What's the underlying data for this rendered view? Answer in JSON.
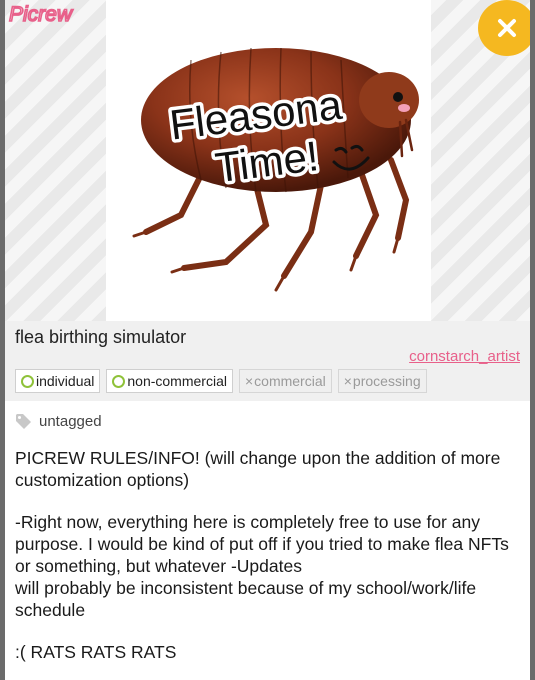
{
  "app": {
    "logo_text": "Picrew"
  },
  "hero": {
    "image_text_line1": "Fleasona",
    "image_text_line2": "Time!"
  },
  "creator": {
    "title": "flea birthing simulator",
    "author": "cornstarch_artist"
  },
  "permissions": [
    {
      "label": "individual",
      "allowed": true
    },
    {
      "label": "non-commercial",
      "allowed": true
    },
    {
      "label": "commercial",
      "allowed": false
    },
    {
      "label": "processing",
      "allowed": false
    }
  ],
  "tags_label": "untagged",
  "description": {
    "p1": "PICREW RULES/INFO! (will change upon the addition of more customization options)",
    "p2a": "-Right now, everything here is completely free to use for any purpose. I would be kind of put off if you tried to make flea NFTs or something, but whatever -Updates",
    "p2b": "will probably be inconsistent because of my school/work/life schedule",
    "p3": ":( RATS RATS RATS"
  },
  "colors": {
    "accent_pink": "#e8608a",
    "close_yellow": "#f5b820",
    "allowed_green": "#8fc23a"
  },
  "icons": {
    "close": "close-icon",
    "tag": "tag-icon"
  }
}
